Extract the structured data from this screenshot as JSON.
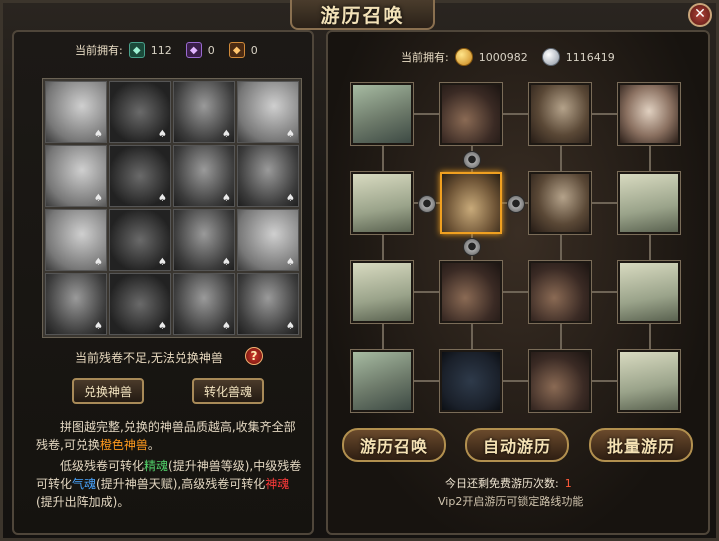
{
  "window": {
    "title": "游历召唤",
    "close_glyph": "✕"
  },
  "left_panel": {
    "owned_label": "当前拥有:",
    "resources": [
      {
        "icon": "green-fragment-icon",
        "value": "112"
      },
      {
        "icon": "purple-fragment-icon",
        "value": "0"
      },
      {
        "icon": "orange-fragment-icon",
        "value": "0"
      }
    ],
    "warning": "当前残卷不足,无法兑换神兽",
    "help_glyph": "?",
    "exchange_button": "兑换神兽",
    "convert_button": "转化兽魂",
    "desc1_a": "拼图越完整,兑换的神兽品质越高,收集齐全部残卷,可兑换",
    "desc1_b": "橙色神兽",
    "desc1_c": "。",
    "desc2_a": "低级残卷可转化",
    "desc2_b": "精魂",
    "desc2_c": "(提升神兽等级),中级残卷可转化",
    "desc2_d": "气魂",
    "desc2_e": "(提升神兽天赋),高级残卷可转化",
    "desc2_f": "神魂",
    "desc2_g": "(提升出阵加成)。"
  },
  "right_panel": {
    "owned_label": "当前拥有:",
    "gold": "1000982",
    "silver": "1116419",
    "summon_button": "游历召唤",
    "auto_button": "自动游历",
    "batch_button": "批量游历",
    "free_label": "今日还剩免费游历次数:",
    "free_count": "1",
    "vip_note": "Vip2开启游历可锁定路线功能"
  },
  "colors": {
    "accent_orange": "#ff9a1e",
    "soul_green": "#52d36a",
    "soul_blue": "#4aa6ff",
    "soul_red": "#ff3a3a",
    "selected_border": "#f0a020"
  }
}
